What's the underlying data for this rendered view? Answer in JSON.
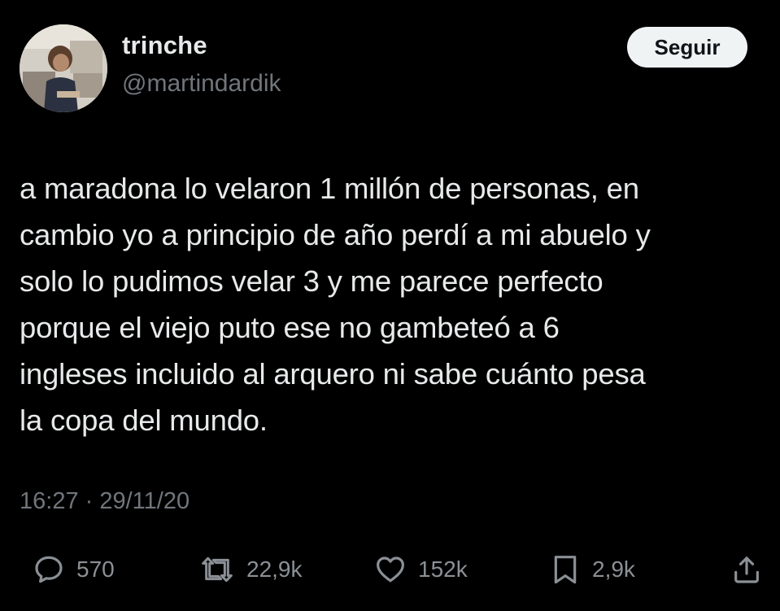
{
  "user": {
    "display_name": "trinche",
    "handle": "@martindardik",
    "avatar": "avatar-photo"
  },
  "follow_button": {
    "label": "Seguir"
  },
  "tweet": {
    "text": "a maradona lo velaron 1 millón de personas, en\ncambio yo a principio de año perdí a mi abuelo y\nsolo lo pudimos velar 3 y me parece perfecto\nporque el viejo puto ese no gambeteó a 6\ningleses incluido al arquero ni sabe cuánto pesa\nla copa del mundo.",
    "timestamp": "16:27 · 29/11/20"
  },
  "actions": {
    "reply": {
      "icon": "reply-icon",
      "count": "570"
    },
    "retweet": {
      "icon": "retweet-icon",
      "count": "22,9k"
    },
    "like": {
      "icon": "heart-icon",
      "count": "152k"
    },
    "bookmark": {
      "icon": "bookmark-icon",
      "count": "2,9k"
    },
    "share": {
      "icon": "share-icon"
    }
  },
  "colors": {
    "background": "#000000",
    "primary_text": "#e7e9ea",
    "secondary_text": "#71767b",
    "button_bg": "#eff3f4",
    "button_text": "#0f1419"
  }
}
